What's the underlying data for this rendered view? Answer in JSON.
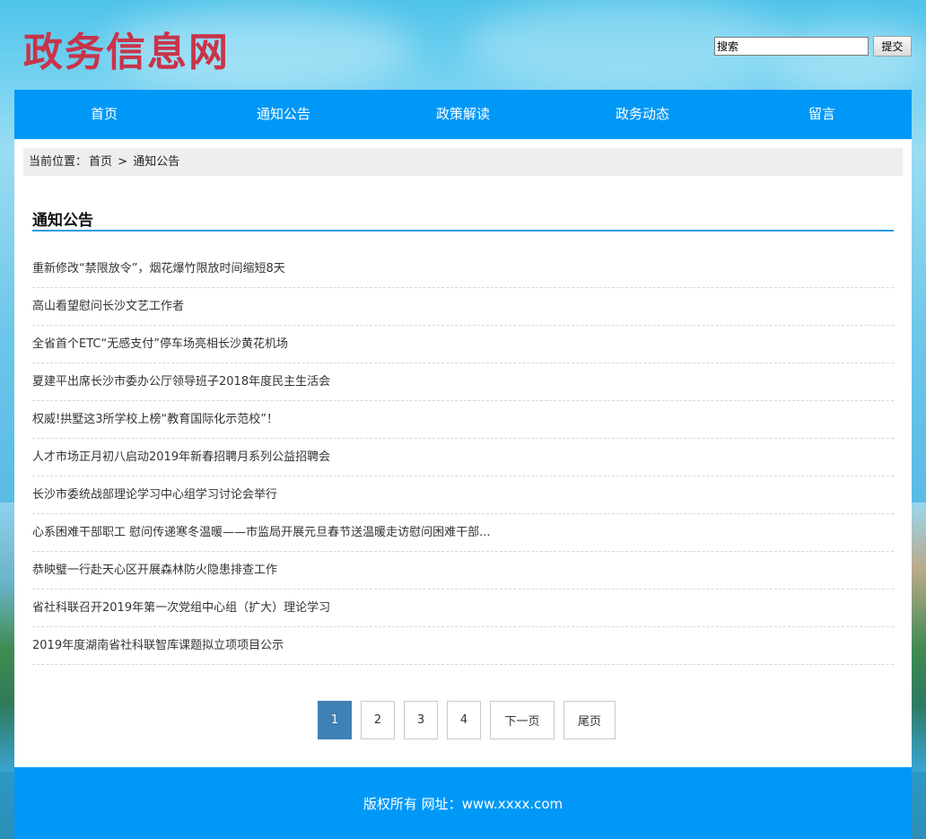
{
  "site": {
    "logo_text": "政务信息网"
  },
  "search": {
    "input_value": "搜索",
    "button_label": "提交"
  },
  "nav": {
    "items": [
      "首页",
      "通知公告",
      "政策解读",
      "政务动态",
      "留言"
    ]
  },
  "breadcrumb": {
    "prefix": "当前位置：",
    "home": "首页",
    "separator": ">",
    "current": "通知公告"
  },
  "section": {
    "title": "通知公告"
  },
  "articles": [
    "重新修改“禁限放令”，烟花爆竹限放时间缩短8天",
    "高山看望慰问长沙文艺工作者",
    "全省首个ETC“无感支付”停车场亮相长沙黄花机场",
    "夏建平出席长沙市委办公厅领导班子2018年度民主生活会",
    "权威!拱墅这3所学校上榜“教育国际化示范校”！",
    "人才市场正月初八启动2019年新春招聘月系列公益招聘会",
    "长沙市委统战部理论学习中心组学习讨论会举行",
    "心系困难干部职工 慰问传递寒冬温暖——市监局开展元旦春节送温暖走访慰问困难干部...",
    "恭映璧一行赴天心区开展森林防火隐患排查工作",
    "省社科联召开2019年第一次党组中心组（扩大）理论学习",
    "2019年度湖南省社科联智库课题拟立项项目公示"
  ],
  "pagination": {
    "pages": [
      "1",
      "2",
      "3",
      "4"
    ],
    "active_page": "1",
    "next_label": "下一页",
    "last_label": "尾页"
  },
  "footer": {
    "text": "版权所有 网址：www.xxxx.com"
  },
  "colors": {
    "nav_bg": "#0098f7",
    "logo": "#c8344a",
    "active_page": "#3f80b5",
    "title_underline": "#1e9be0"
  }
}
